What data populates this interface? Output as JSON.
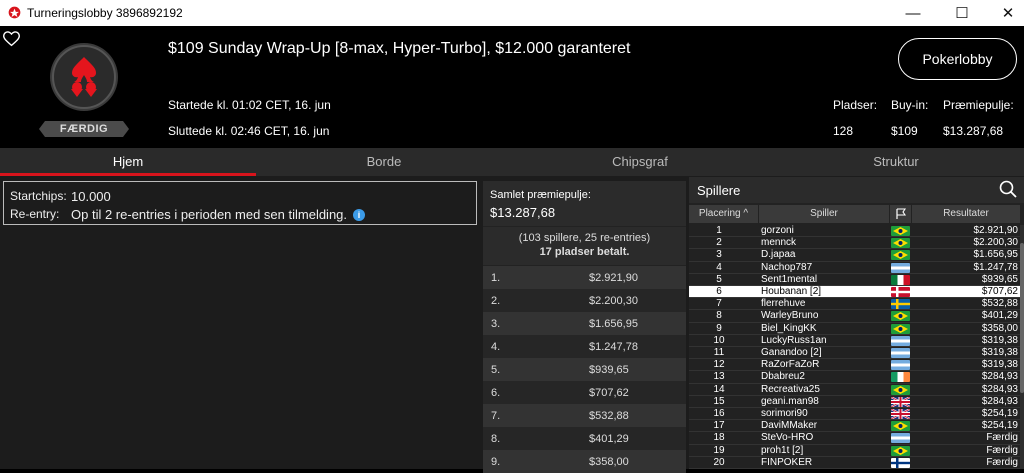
{
  "window": {
    "title": "Turneringslobby 3896892192"
  },
  "header": {
    "status_badge": "FÆRDIG",
    "tournament_title": "$109 Sunday Wrap-Up [8-max, Hyper-Turbo], $12.000 garanteret",
    "started": "Startede kl. 01:02 CET, 16. jun",
    "ended": "Sluttede kl. 02:46 CET, 16. jun",
    "lobby_button": "Pokerlobby",
    "stats": [
      {
        "label": "Pladser:",
        "value": "128"
      },
      {
        "label": "Buy-in:",
        "value": "$109"
      },
      {
        "label": "Præmiepulje:",
        "value": "$13.287,68"
      }
    ]
  },
  "tabs": [
    "Hjem",
    "Borde",
    "Chipsgraf",
    "Struktur"
  ],
  "info": {
    "startchips_label": "Startchips:",
    "startchips_value": "10.000",
    "reentry_label": "Re-entry:",
    "reentry_value": "Op til 2 re-entries i perioden med sen tilmelding."
  },
  "prizes": {
    "total_label": "Samlet præmiepulje:",
    "total_value": "$13.287,68",
    "entries_note": "(103 spillere, 25 re-entries)",
    "paid_note": "17 pladser betalt.",
    "rows": [
      {
        "place": "1.",
        "amount": "$2.921,90"
      },
      {
        "place": "2.",
        "amount": "$2.200,30"
      },
      {
        "place": "3.",
        "amount": "$1.656,95"
      },
      {
        "place": "4.",
        "amount": "$1.247,78"
      },
      {
        "place": "5.",
        "amount": "$939,65"
      },
      {
        "place": "6.",
        "amount": "$707,62"
      },
      {
        "place": "7.",
        "amount": "$532,88"
      },
      {
        "place": "8.",
        "amount": "$401,29"
      },
      {
        "place": "9.",
        "amount": "$358,00"
      }
    ]
  },
  "players": {
    "title": "Spillere",
    "col_place": "Placering",
    "col_player": "Spiller",
    "col_results": "Resultater",
    "rows": [
      {
        "place": "1",
        "name": "gorzoni",
        "flag": "br",
        "result": "$2.921,90"
      },
      {
        "place": "2",
        "name": "mennck",
        "flag": "br",
        "result": "$2.200,30"
      },
      {
        "place": "3",
        "name": "D.japaa",
        "flag": "br",
        "result": "$1.656,95"
      },
      {
        "place": "4",
        "name": "Nachop787",
        "flag": "ar",
        "result": "$1.247,78"
      },
      {
        "place": "5",
        "name": "Sent1mental",
        "flag": "mx",
        "result": "$939,65"
      },
      {
        "place": "6",
        "name": "Houbanan [2]",
        "flag": "dk",
        "result": "$707,62",
        "highlight": true
      },
      {
        "place": "7",
        "name": "flerrehuve",
        "flag": "se",
        "result": "$532,88"
      },
      {
        "place": "8",
        "name": "WarleyBruno",
        "flag": "br",
        "result": "$401,29"
      },
      {
        "place": "9",
        "name": "Biel_KingKK",
        "flag": "br",
        "result": "$358,00"
      },
      {
        "place": "10",
        "name": "LuckyRuss1an",
        "flag": "ar",
        "result": "$319,38"
      },
      {
        "place": "11",
        "name": "Ganandoo [2]",
        "flag": "ar",
        "result": "$319,38"
      },
      {
        "place": "12",
        "name": "RaZorFaZoR",
        "flag": "ar",
        "result": "$319,38"
      },
      {
        "place": "13",
        "name": "Dbabreu2",
        "flag": "ie",
        "result": "$284,93"
      },
      {
        "place": "14",
        "name": "Recreativa25",
        "flag": "br",
        "result": "$284,93"
      },
      {
        "place": "15",
        "name": "geani.man98",
        "flag": "gb",
        "result": "$284,93"
      },
      {
        "place": "16",
        "name": "sorimori90",
        "flag": "gb",
        "result": "$254,19"
      },
      {
        "place": "17",
        "name": "DaviMMaker",
        "flag": "br",
        "result": "$254,19"
      },
      {
        "place": "18",
        "name": "SteVo-HRO",
        "flag": "ar",
        "result": "Færdig"
      },
      {
        "place": "19",
        "name": "proh1t [2]",
        "flag": "br",
        "result": "Færdig"
      },
      {
        "place": "20",
        "name": "FINPOKER",
        "flag": "fi",
        "result": "Færdig"
      }
    ]
  },
  "colors": {
    "accent": "#d8141c",
    "info": "#3b9be8"
  }
}
